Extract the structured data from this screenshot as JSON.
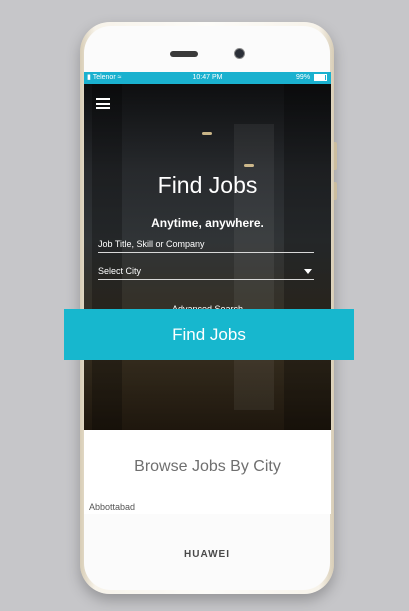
{
  "device": {
    "brand": "HUAWEI"
  },
  "status_bar": {
    "carrier": "Telenor",
    "time": "10:47 PM",
    "battery": "99%",
    "signal_icon": "signal-icon",
    "wifi_icon": "wifi-icon",
    "battery_icon": "battery-icon"
  },
  "hero": {
    "menu_icon": "menu-icon",
    "title": "Find Jobs",
    "subtitle": "Anytime, anywhere.",
    "job_placeholder": "Job Title, Skill or Company",
    "city_select": "Select City",
    "advanced_search": "Advanced Search"
  },
  "find_button": {
    "label": "Find Jobs"
  },
  "browse": {
    "title": "Browse Jobs By City",
    "cities": [
      "Abbottabad"
    ]
  },
  "colors": {
    "accent": "#17b7ce",
    "status_bar": "#1ab1cf"
  }
}
